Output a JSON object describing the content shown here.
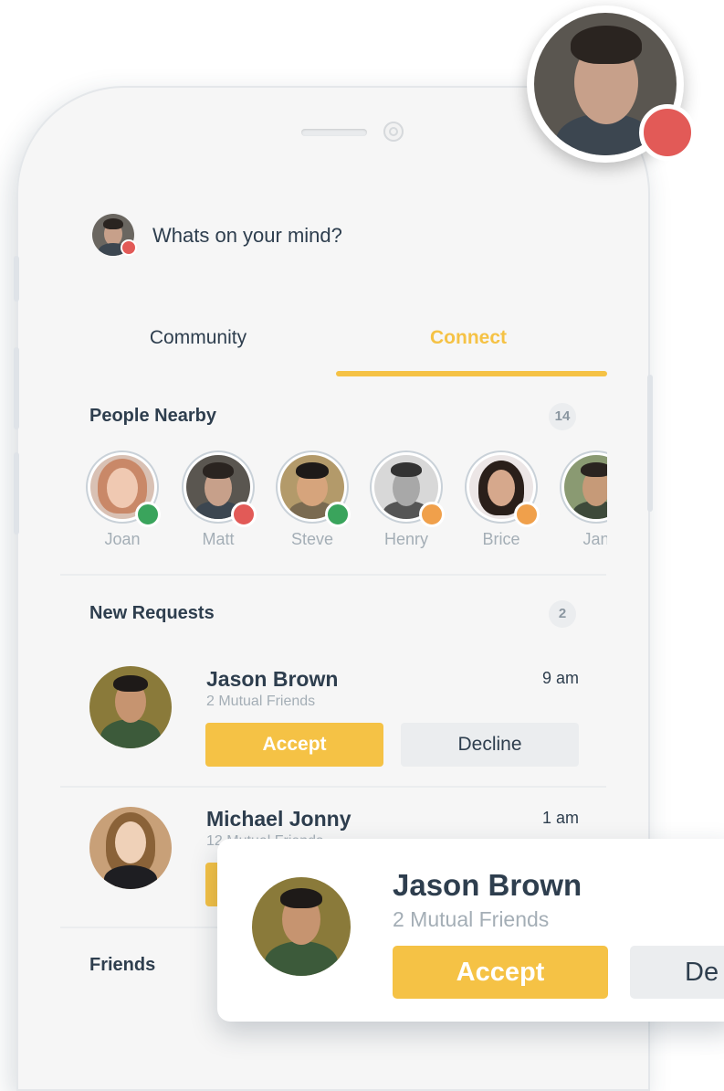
{
  "composer": {
    "placeholder_text": "Whats on your mind?"
  },
  "tabs": [
    {
      "label": "Community",
      "active": false
    },
    {
      "label": "Connect",
      "active": true
    }
  ],
  "people_nearby": {
    "title": "People Nearby",
    "count": "14",
    "people": [
      {
        "name": "Joan",
        "status": "online"
      },
      {
        "name": "Matt",
        "status": "busy"
      },
      {
        "name": "Steve",
        "status": "online"
      },
      {
        "name": "Henry",
        "status": "away"
      },
      {
        "name": "Brice",
        "status": "away"
      },
      {
        "name": "Jan",
        "status": "online"
      }
    ]
  },
  "new_requests": {
    "title": "New Requests",
    "count": "2",
    "items": [
      {
        "name": "Jason Brown",
        "mutual": "2 Mutual Friends",
        "time": "9 am",
        "accept_label": "Accept",
        "decline_label": "Decline"
      },
      {
        "name": "Michael Jonny",
        "mutual": "12 Mutual Friends",
        "time": "1 am"
      }
    ]
  },
  "friends": {
    "title": "Friends"
  },
  "popup_card": {
    "name": "Jason Brown",
    "mutual": "2 Mutual Friends",
    "accept_label": "Accept",
    "decline_label": "De"
  },
  "colors": {
    "accent": "#f5c245",
    "online": "#3aa45c",
    "busy": "#e25a57",
    "away": "#f0a04b",
    "text": "#2e3e4e",
    "muted": "#a4aeb6"
  },
  "icons": [
    "profile-photo",
    "status-dot",
    "camera-icon"
  ]
}
